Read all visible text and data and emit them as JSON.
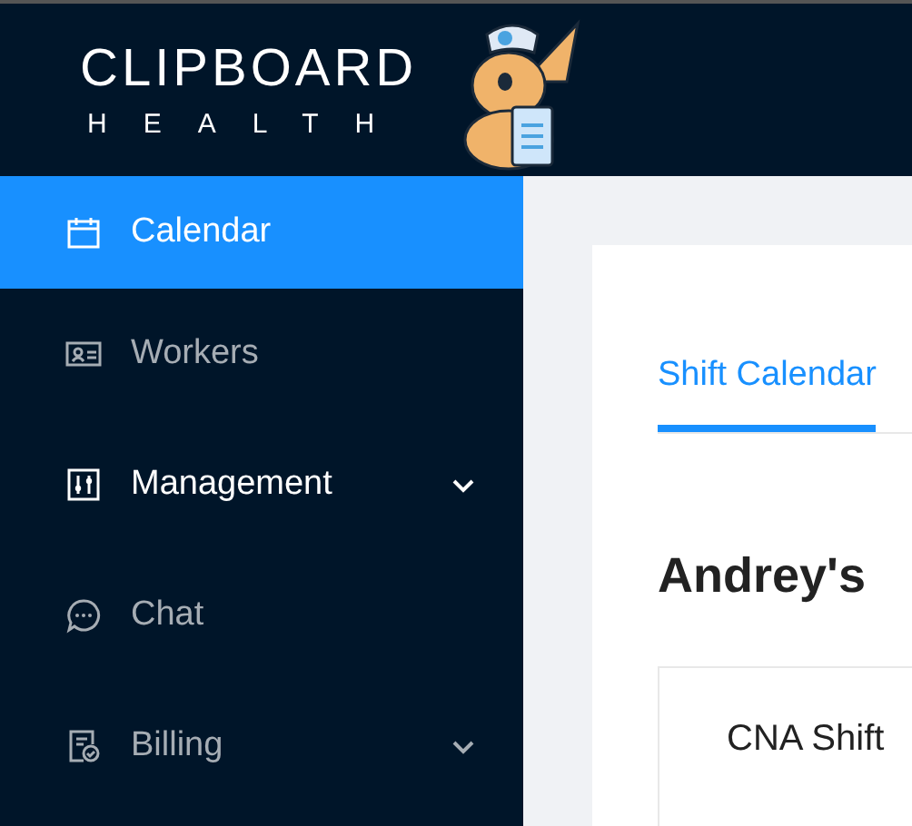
{
  "header": {
    "logo_title": "CLIPBOARD",
    "logo_subtitle": "HEALTH"
  },
  "sidebar": {
    "items": [
      {
        "label": "Calendar",
        "selected": true,
        "emphasized": false,
        "has_submenu": false
      },
      {
        "label": "Workers",
        "selected": false,
        "emphasized": false,
        "has_submenu": false
      },
      {
        "label": "Management",
        "selected": false,
        "emphasized": true,
        "has_submenu": true
      },
      {
        "label": "Chat",
        "selected": false,
        "emphasized": false,
        "has_submenu": false
      },
      {
        "label": "Billing",
        "selected": false,
        "emphasized": false,
        "has_submenu": true
      }
    ]
  },
  "tabs": [
    {
      "label": "Shift Calendar",
      "selected": true
    }
  ],
  "heading": "Andrey's",
  "panel": {
    "title": "CNA Shift"
  }
}
